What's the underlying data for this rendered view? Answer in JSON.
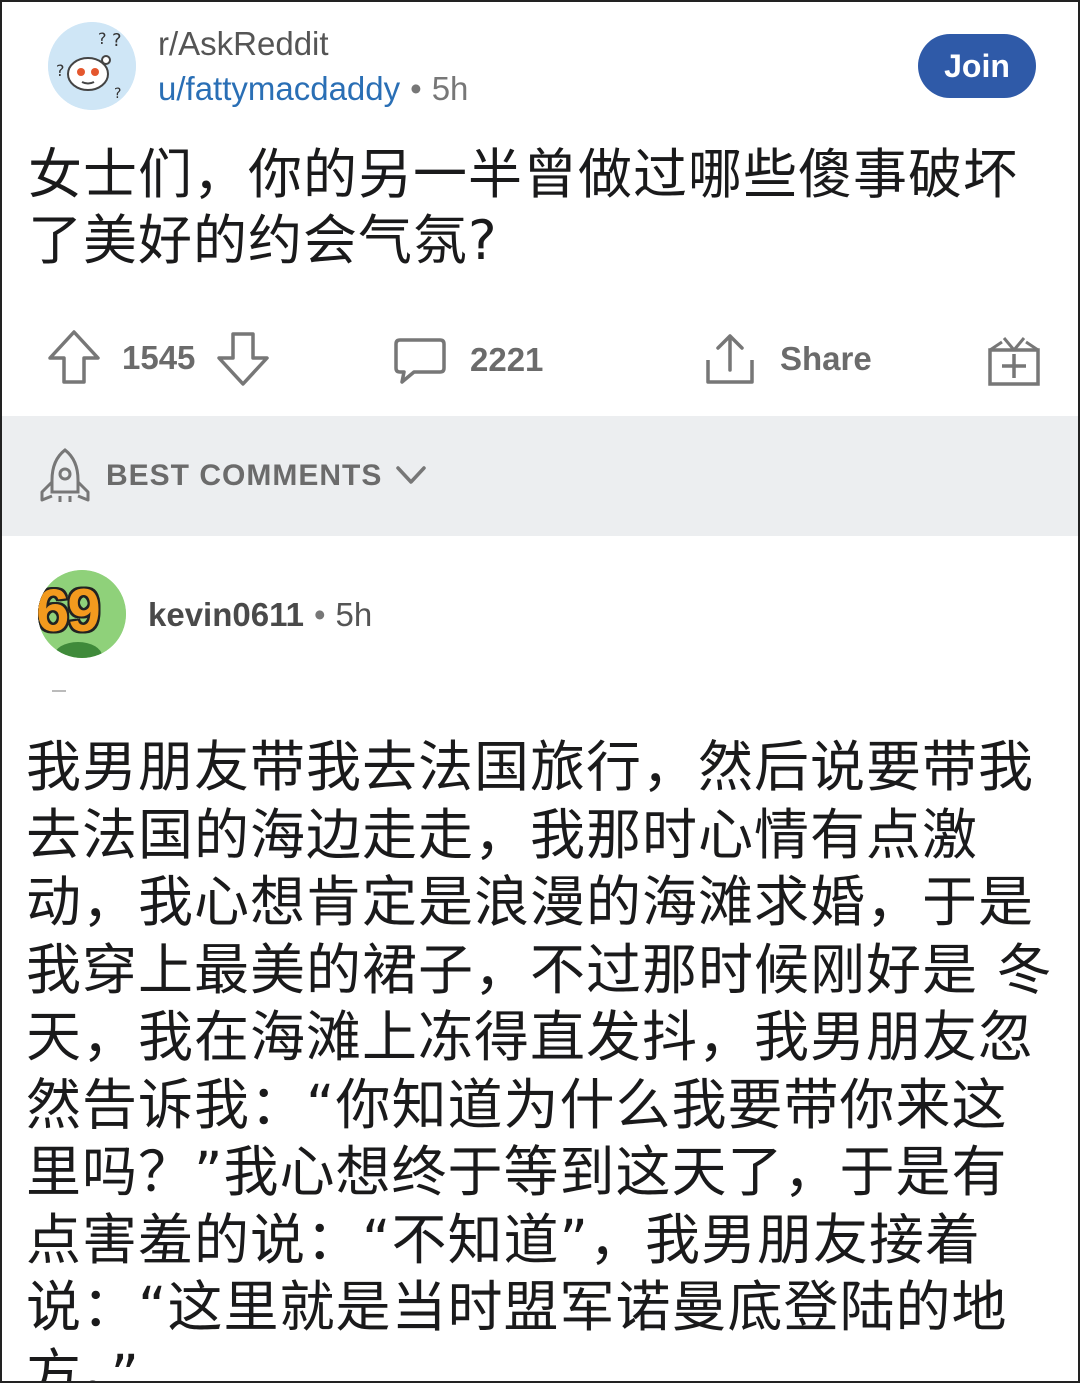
{
  "post": {
    "subreddit": "r/AskReddit",
    "author": "u/fattymacdaddy",
    "age": "5h",
    "join_label": "Join",
    "title": "女士们，你的另一半曾做过哪些傻事破坏了美好的约会气氛?",
    "votes": "1545",
    "comments": "2221",
    "share_label": "Share"
  },
  "sort": {
    "label": "BEST COMMENTS"
  },
  "comment": {
    "avatar_text": "69",
    "author": "kevin0611",
    "age": "5h",
    "body": "我男朋友带我去法国旅行，然后说要带我去法国的海边走走，我那时心情有点激动，我心想肯定是浪漫的海滩求婚，于是我穿上最美的裙子，不过那时候刚好是 冬天，我在海滩上冻得直发抖，我男朋友忽然告诉我：“你知道为什么我要带你来这里吗？”我心想终于等到这天了，于是有点害羞的说：“不知道”，我男朋友接着说：“这里就是当时盟军诺曼底登陆的地方。”"
  },
  "colors": {
    "join_bg": "#2f5aa8",
    "author_link": "#2a6fb5",
    "sort_bg": "#eceef0",
    "avatar_green": "#8fd17a",
    "avatar_digits": "#f39a1e"
  },
  "icons": [
    "upvote-icon",
    "downvote-icon",
    "comment-icon",
    "share-icon",
    "award-icon",
    "rocket-icon",
    "chevron-down-icon"
  ]
}
